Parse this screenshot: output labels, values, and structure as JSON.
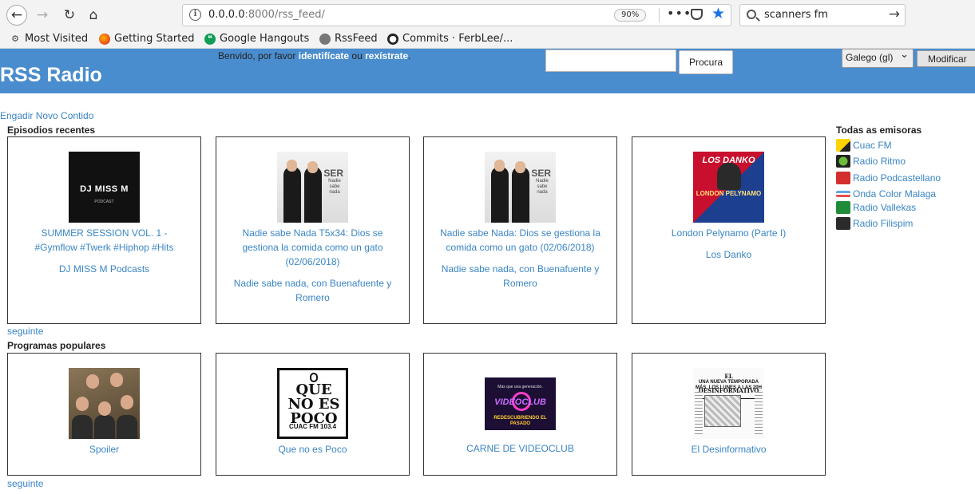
{
  "browser": {
    "url_host": "0.0.0.0",
    "url_rest": ":8000/rss_feed/",
    "zoom": "90%",
    "search_query": "scanners fm",
    "bookmarks": [
      {
        "label": "Most Visited",
        "icon": "gear-icon"
      },
      {
        "label": "Getting Started",
        "icon": "firefox-icon"
      },
      {
        "label": "Google Hangouts",
        "icon": "hangouts-icon"
      },
      {
        "label": "RssFeed",
        "icon": "globe-icon"
      },
      {
        "label": "Commits · FerbLee/...",
        "icon": "github-icon"
      }
    ]
  },
  "header": {
    "brand": "RSS Radio",
    "welcome_prefix": "Benvido, por favor ",
    "login_link": "identifícate",
    "welcome_mid": " ou ",
    "register_link": "rexístrate",
    "welcome_suffix": ".",
    "search_placeholder": "",
    "search_button": "Procura",
    "language": "Galego (gl)",
    "modify_button": "Modificar"
  },
  "main": {
    "add_content": "Engadir Novo Contido",
    "recent_title": "Episodios recentes",
    "recent": [
      {
        "title": "SUMMER SESSION VOL. 1 - #Gymflow #Twerk #Hiphop #Hits",
        "program": "DJ MISS M Podcasts"
      },
      {
        "title": "Nadie sabe Nada T5x34: Dios se gestiona la comida como un gato (02/06/2018)",
        "program": "Nadie sabe nada, con Buenafuente y Romero"
      },
      {
        "title": "Nadie sabe Nada: Dios se gestiona la comida como un gato (02/06/2018)",
        "program": "Nadie sabe nada, con Buenafuente y Romero"
      },
      {
        "title": "London Pelynamo (Parte I)",
        "program": "Los Danko"
      }
    ],
    "next_label": "seguinte",
    "popular_title": "Programas populares",
    "popular": [
      {
        "title": "Spoiler"
      },
      {
        "title": "Que no es Poco"
      },
      {
        "title": "CARNE DE VIDEOCLUB"
      },
      {
        "title": "El Desinformativo"
      }
    ]
  },
  "artwork_text": {
    "missm": "DJ MISS M",
    "missm_sub": "PODCAST",
    "ser": "SER",
    "ser_sub": "Nadie sabe nada",
    "danko_top": "LOS DANKO",
    "danko_bottom": "LONDON PELYNAMO",
    "qnep": "QUE NO ES POCO",
    "qnep_station": "CUAC FM 103.4",
    "video_top": "Más que una generación.",
    "video_mid": "VIDEOCLUB",
    "video_bottom": "REDESCUBRIENDO EL PASADO",
    "desinfo_head": "EL DESINFORMATIVO",
    "desinfo_headline": "UNA NUEVA TEMPORADA MÁS, LOS LUNES A LAS 20H"
  },
  "sidebar": {
    "title": "Todas as emisoras",
    "stations": [
      {
        "name": "Cuac FM"
      },
      {
        "name": "Radio Ritmo"
      },
      {
        "name": "Radio Podcastellano"
      },
      {
        "name": "Onda Color Malaga"
      },
      {
        "name": "Radio Vallekas"
      },
      {
        "name": "Radio Filispim"
      }
    ]
  },
  "colors": {
    "header_bg": "#4a8dce",
    "link": "#3a85c6"
  }
}
